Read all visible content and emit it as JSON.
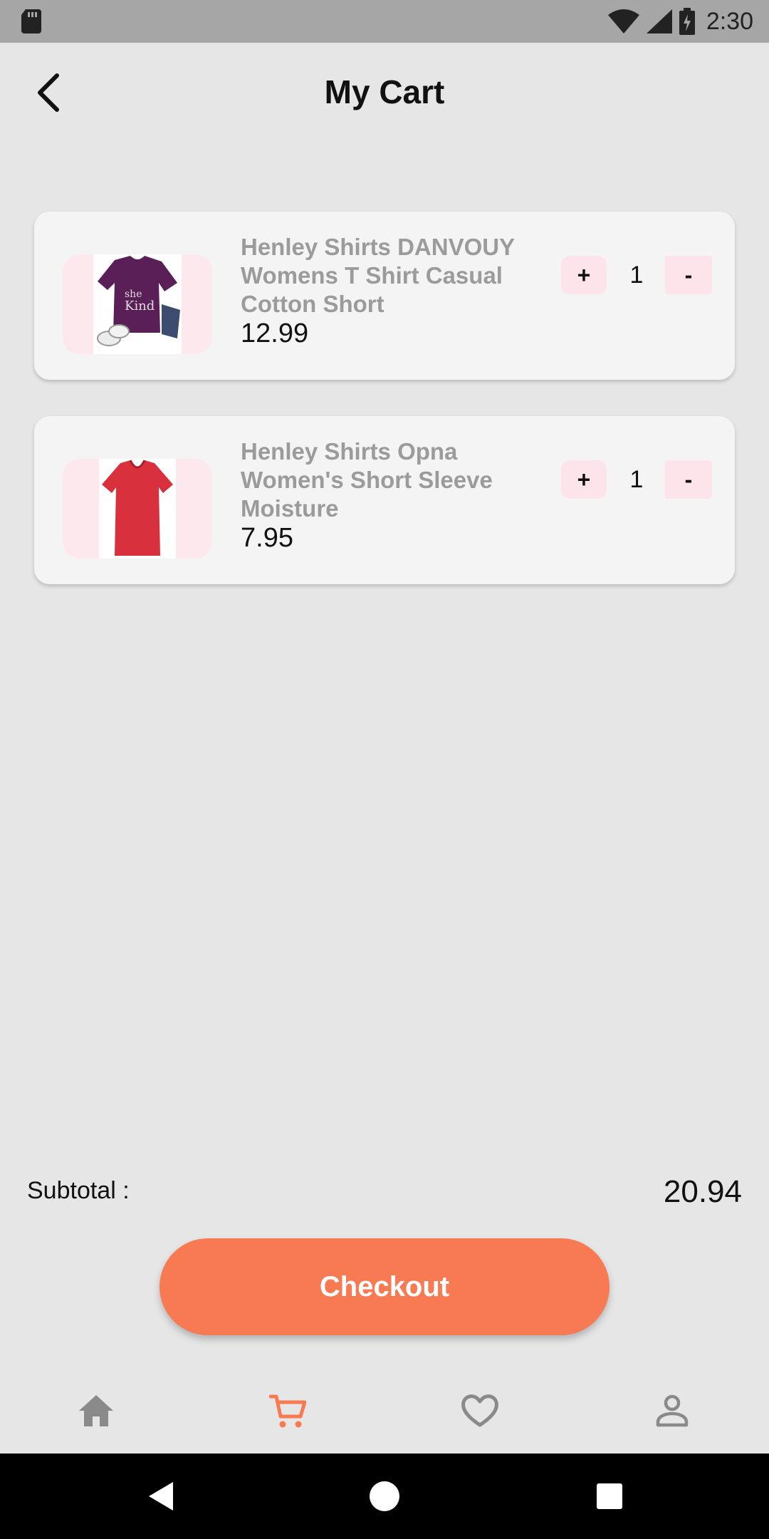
{
  "status_bar": {
    "time": "2:30"
  },
  "header": {
    "title": "My Cart"
  },
  "cart": {
    "items": [
      {
        "name": "Henley Shirts DANVOUY Womens T Shirt Casual Cotton Short",
        "price": "12.99",
        "quantity": "1",
        "plus_label": "+",
        "minus_label": "-"
      },
      {
        "name": "Henley Shirts Opna Women's Short Sleeve Moisture",
        "price": "7.95",
        "quantity": "1",
        "plus_label": "+",
        "minus_label": "-"
      }
    ]
  },
  "summary": {
    "subtotal_label": "Subtotal :",
    "subtotal_value": "20.94"
  },
  "checkout": {
    "label": "Checkout"
  },
  "nav": {
    "items": [
      {
        "icon": "home-icon",
        "active": false
      },
      {
        "icon": "cart-icon",
        "active": true
      },
      {
        "icon": "heart-icon",
        "active": false
      },
      {
        "icon": "profile-icon",
        "active": false
      }
    ],
    "active_color": "#f77a52",
    "inactive_color": "#8a8a8a"
  },
  "colors": {
    "accent": "#f77a52",
    "thumb_bg": "#fde9ed"
  }
}
